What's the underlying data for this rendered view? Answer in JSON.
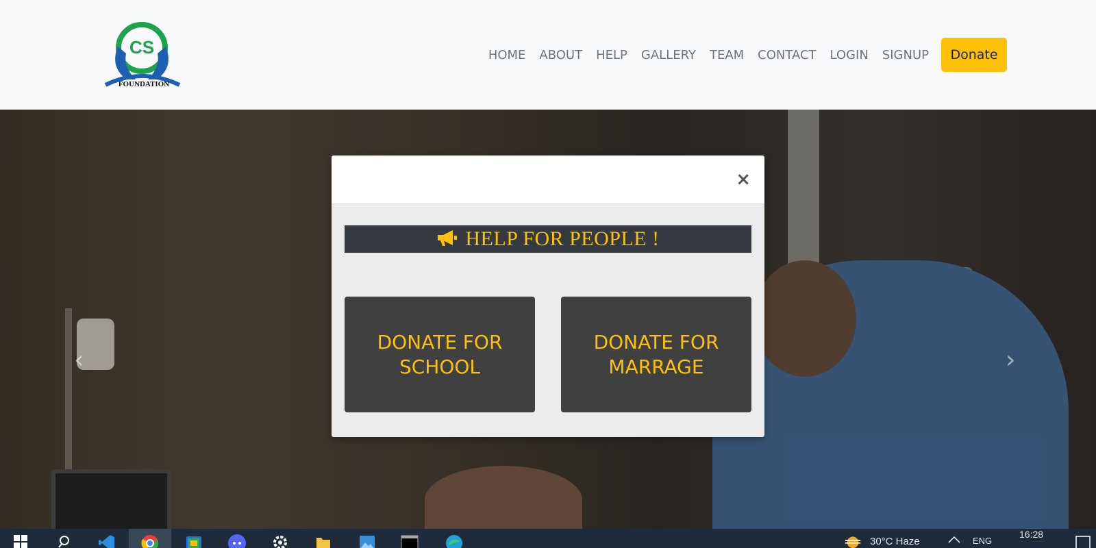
{
  "brand": {
    "logo_initials": "CS",
    "logo_text": "FOUNDATION"
  },
  "nav": {
    "items": [
      "HOME",
      "ABOUT",
      "HELP",
      "GALLERY",
      "TEAM",
      "CONTACT",
      "LOGIN",
      "SIGNUP"
    ],
    "donate_label": "Donate"
  },
  "carousel": {
    "prev_icon": "chevron-left-icon",
    "next_icon": "chevron-right-icon"
  },
  "modal": {
    "close_label": "×",
    "banner_icon": "megaphone-icon",
    "banner_text": "HELP FOR PEOPLE !",
    "cards": [
      {
        "label": "DONATE FOR SCHOOL"
      },
      {
        "label": "DONATE FOR MARRAGE"
      }
    ]
  },
  "taskbar": {
    "weather": "30°C  Haze",
    "language": "ENG",
    "time": "16:28",
    "apps": [
      "windows-start-icon",
      "search-icon",
      "vscode-icon",
      "chrome-icon",
      "files-icon",
      "discord-icon",
      "settings-icon",
      "file-explorer-icon",
      "photos-icon",
      "terminal-icon",
      "edge-icon"
    ]
  },
  "colors": {
    "accent": "#ffc107",
    "navbar_bg": "#f8f9fa",
    "banner_bg": "#343a40",
    "card_bg": "#404040"
  }
}
